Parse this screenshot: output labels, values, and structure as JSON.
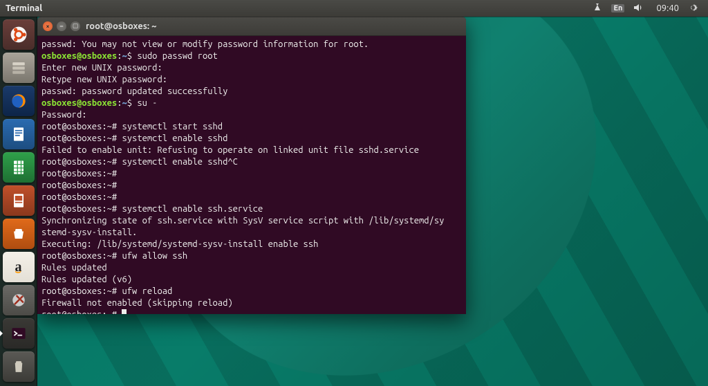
{
  "panel": {
    "app_name": "Terminal",
    "lang": "En",
    "clock": "09:40"
  },
  "launcher": {
    "items": [
      {
        "name": "dash",
        "label": "Dash",
        "active": false
      },
      {
        "name": "files",
        "label": "Files",
        "active": false
      },
      {
        "name": "firefox",
        "label": "Firefox",
        "active": false
      },
      {
        "name": "writer",
        "label": "LibreOffice Writer",
        "active": false
      },
      {
        "name": "calc",
        "label": "LibreOffice Calc",
        "active": false
      },
      {
        "name": "impress",
        "label": "LibreOffice Impress",
        "active": false
      },
      {
        "name": "software",
        "label": "Ubuntu Software",
        "active": false
      },
      {
        "name": "amazon",
        "label": "Amazon",
        "active": false
      },
      {
        "name": "settings",
        "label": "System Settings",
        "active": false
      },
      {
        "name": "terminal",
        "label": "Terminal",
        "active": true
      }
    ],
    "trash_label": "Trash"
  },
  "window": {
    "title": "root@osboxes: ~",
    "close": "×",
    "min": "–",
    "max": "▢"
  },
  "prompt": {
    "user_color_user": "osboxes",
    "at": "@",
    "host": "osboxes",
    "user_sep": ":",
    "path": "~",
    "user_suffix": "$",
    "root_user": "root",
    "root_suffix": "#"
  },
  "lines": [
    {
      "t": "out",
      "text": "passwd: You may not view or modify password information for root."
    },
    {
      "t": "user",
      "cmd": "sudo passwd root"
    },
    {
      "t": "out",
      "text": "Enter new UNIX password:"
    },
    {
      "t": "out",
      "text": "Retype new UNIX password:"
    },
    {
      "t": "out",
      "text": "passwd: password updated successfully"
    },
    {
      "t": "user",
      "cmd": "su -"
    },
    {
      "t": "out",
      "text": "Password:"
    },
    {
      "t": "root",
      "cmd": "systemctl start sshd"
    },
    {
      "t": "root",
      "cmd": "systemctl enable sshd"
    },
    {
      "t": "out",
      "text": "Failed to enable unit: Refusing to operate on linked unit file sshd.service"
    },
    {
      "t": "root",
      "cmd": "systemctl enable sshd^C"
    },
    {
      "t": "root",
      "cmd": ""
    },
    {
      "t": "root",
      "cmd": ""
    },
    {
      "t": "root",
      "cmd": ""
    },
    {
      "t": "root",
      "cmd": "systemctl enable ssh.service"
    },
    {
      "t": "out",
      "text": "Synchronizing state of ssh.service with SysV service script with /lib/systemd/sy"
    },
    {
      "t": "out",
      "text": "stemd-sysv-install."
    },
    {
      "t": "out",
      "text": "Executing: /lib/systemd/systemd-sysv-install enable ssh"
    },
    {
      "t": "root",
      "cmd": "ufw allow ssh"
    },
    {
      "t": "out",
      "text": "Rules updated"
    },
    {
      "t": "out",
      "text": "Rules updated (v6)"
    },
    {
      "t": "root",
      "cmd": "ufw reload"
    },
    {
      "t": "out",
      "text": "Firewall not enabled (skipping reload)"
    },
    {
      "t": "root",
      "cmd": "",
      "cursor": true
    }
  ]
}
